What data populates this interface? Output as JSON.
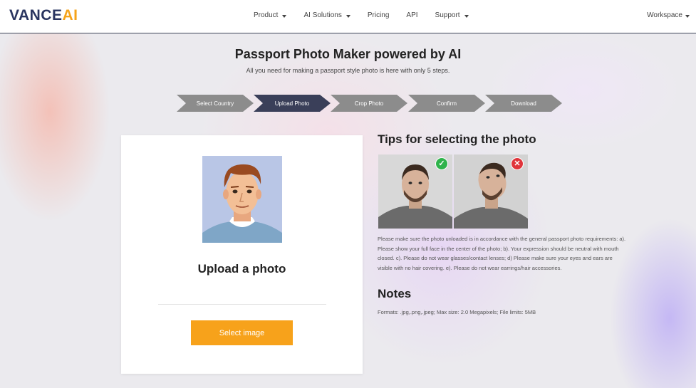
{
  "header": {
    "logo_vance": "VANCE",
    "logo_ai": "AI",
    "nav": [
      {
        "label": "Product",
        "dropdown": true
      },
      {
        "label": "AI Solutions",
        "dropdown": true
      },
      {
        "label": "Pricing",
        "dropdown": false
      },
      {
        "label": "API",
        "dropdown": false
      },
      {
        "label": "Support",
        "dropdown": true
      }
    ],
    "workspace_label": "Workspace"
  },
  "page": {
    "title": "Passport Photo Maker powered by AI",
    "subtitle": "All you need for making a passport style photo is here with only 5 steps."
  },
  "steps": [
    {
      "label": "Select Country",
      "active": false
    },
    {
      "label": "Upload Photo",
      "active": true
    },
    {
      "label": "Crop Photo",
      "active": false
    },
    {
      "label": "Confirm",
      "active": false
    },
    {
      "label": "Download",
      "active": false
    }
  ],
  "upload": {
    "title": "Upload a photo",
    "button_label": "Select image"
  },
  "tips": {
    "title": "Tips for selecting the photo",
    "good_badge": "✓",
    "bad_badge": "✕",
    "text": "Please make sure the photo unloaded is in accordance with the general passport photo requirements: a). Please show your full face in the center of the photo; b). Your expression should be neutral with mouth closed. c). Please do not wear glasses/contact lenses; d) Please make sure your eyes and ears are visible with no hair covering. e). Please do not wear earrings/hair accessories."
  },
  "notes": {
    "title": "Notes",
    "text": "Formats: .jpg,.png,.jpeg; Max size: 2.0 Megapixels; File limits: 5MB"
  },
  "colors": {
    "brand_navy": "#2a3560",
    "brand_orange": "#f5a31a",
    "step_active": "#3a3f59",
    "step_inactive": "#8c8c8c",
    "button": "#f7a21b",
    "good": "#2fb34b",
    "bad": "#e0343b"
  }
}
